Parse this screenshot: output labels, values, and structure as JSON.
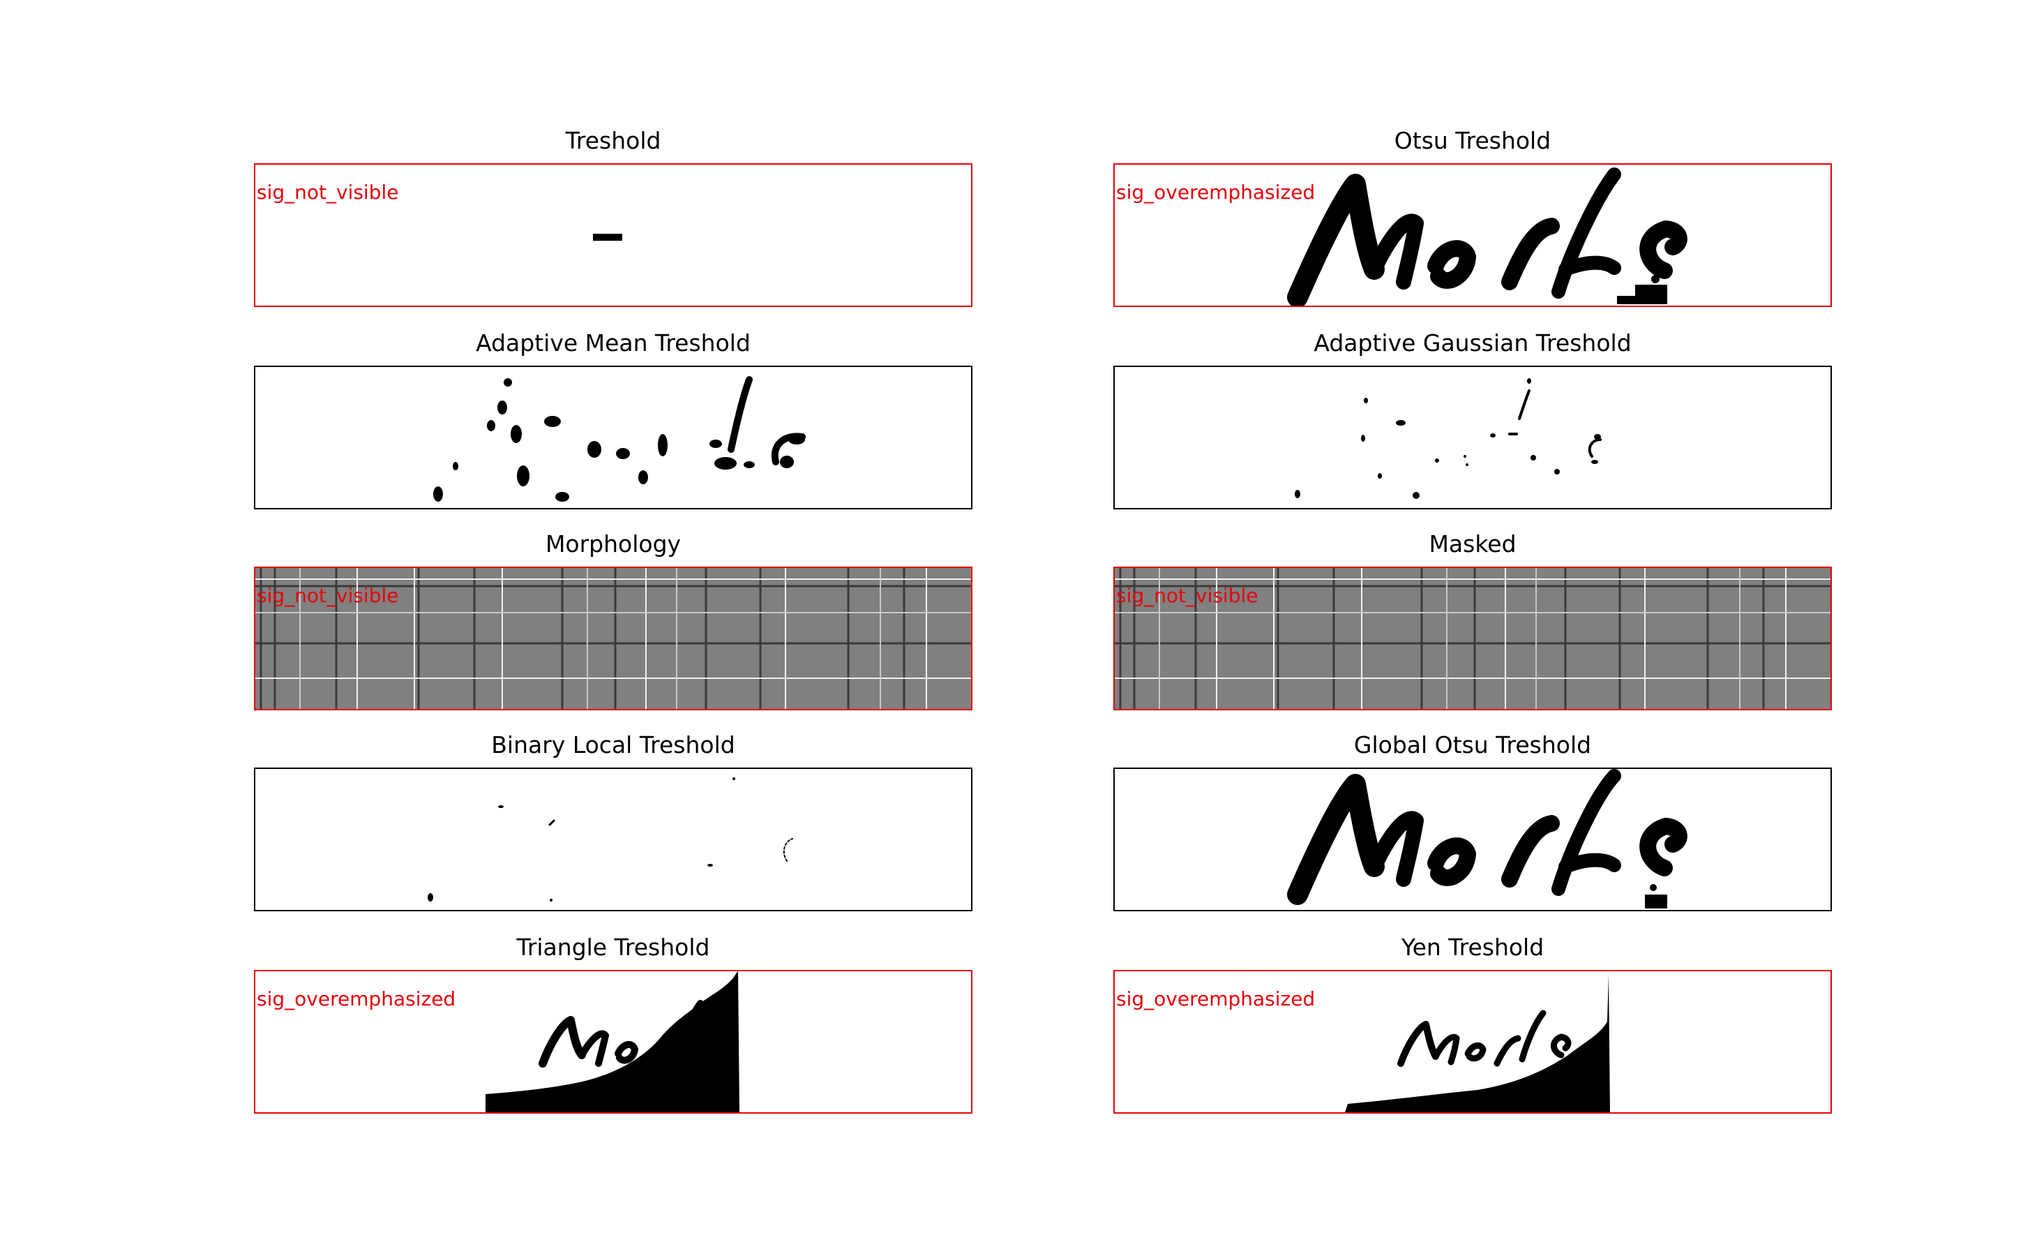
{
  "figure": {
    "panels": [
      {
        "title": "Treshold",
        "flag": "sig_not_visible",
        "status": "flagged",
        "frame_color": "#e8000b",
        "image": "blank"
      },
      {
        "title": "Otsu Treshold",
        "flag": "sig_overemphasized",
        "status": "flagged",
        "frame_color": "#e8000b",
        "image": "otsu"
      },
      {
        "title": "Adaptive Mean Treshold",
        "flag": "",
        "status": "ok",
        "frame_color": "#000000",
        "image": "fragments"
      },
      {
        "title": "Adaptive Gaussian Treshold",
        "flag": "",
        "status": "ok",
        "frame_color": "#000000",
        "image": "sparse"
      },
      {
        "title": "Morphology",
        "flag": "sig_not_visible",
        "status": "flagged",
        "frame_color": "#e8000b",
        "image": "grid"
      },
      {
        "title": "Masked",
        "flag": "sig_not_visible",
        "status": "flagged",
        "frame_color": "#e8000b",
        "image": "grid"
      },
      {
        "title": "Binary Local Treshold",
        "flag": "",
        "status": "ok",
        "frame_color": "#000000",
        "image": "specks"
      },
      {
        "title": "Global Otsu Treshold",
        "flag": "",
        "status": "ok",
        "frame_color": "#000000",
        "image": "otsu"
      },
      {
        "title": "Triangle Treshold",
        "flag": "sig_overemphasized",
        "status": "flagged",
        "frame_color": "#e8000b",
        "image": "triangle"
      },
      {
        "title": "Yen Treshold",
        "flag": "sig_overemphasized",
        "status": "flagged",
        "frame_color": "#e8000b",
        "image": "yen"
      }
    ]
  }
}
